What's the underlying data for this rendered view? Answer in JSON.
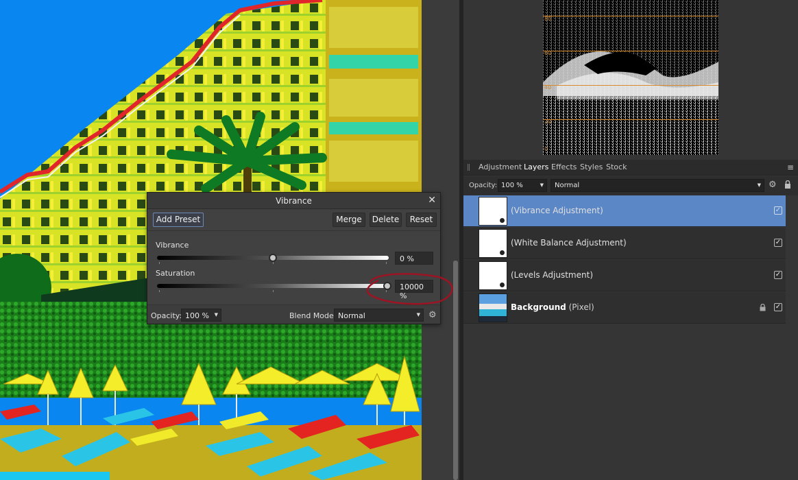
{
  "dialog": {
    "title": "Vibrance",
    "buttons": {
      "add_preset": "Add Preset",
      "merge": "Merge",
      "delete": "Delete",
      "reset": "Reset"
    },
    "vibrance": {
      "label": "Vibrance",
      "value": "0 %",
      "level": 0.5
    },
    "saturation": {
      "label": "Saturation",
      "value": "10000 %",
      "level": 1.0
    },
    "opacity_label": "Opacity:",
    "opacity_value": "100 %",
    "blend_label": "Blend Mode:",
    "blend_value": "Normal"
  },
  "histogram": {
    "labels": [
      "80",
      "60",
      "40",
      "20",
      "0"
    ]
  },
  "panel_tabs": [
    "Adjustment",
    "Layers",
    "Effects",
    "Styles",
    "Stock"
  ],
  "active_tab": "Layers",
  "layer_bar": {
    "opacity_label": "Opacity:",
    "opacity_value": "100 %",
    "blend_value": "Normal"
  },
  "layers": [
    {
      "name": "(Vibrance Adjustment)",
      "selected": true
    },
    {
      "name": "(White Balance Adjustment)",
      "selected": false
    },
    {
      "name": "(Levels Adjustment)",
      "selected": false
    },
    {
      "name": "Background",
      "sub": "(Pixel)",
      "selected": false
    }
  ],
  "colors": {
    "selection": "#5b87c6",
    "annotation": "#9c1424"
  }
}
